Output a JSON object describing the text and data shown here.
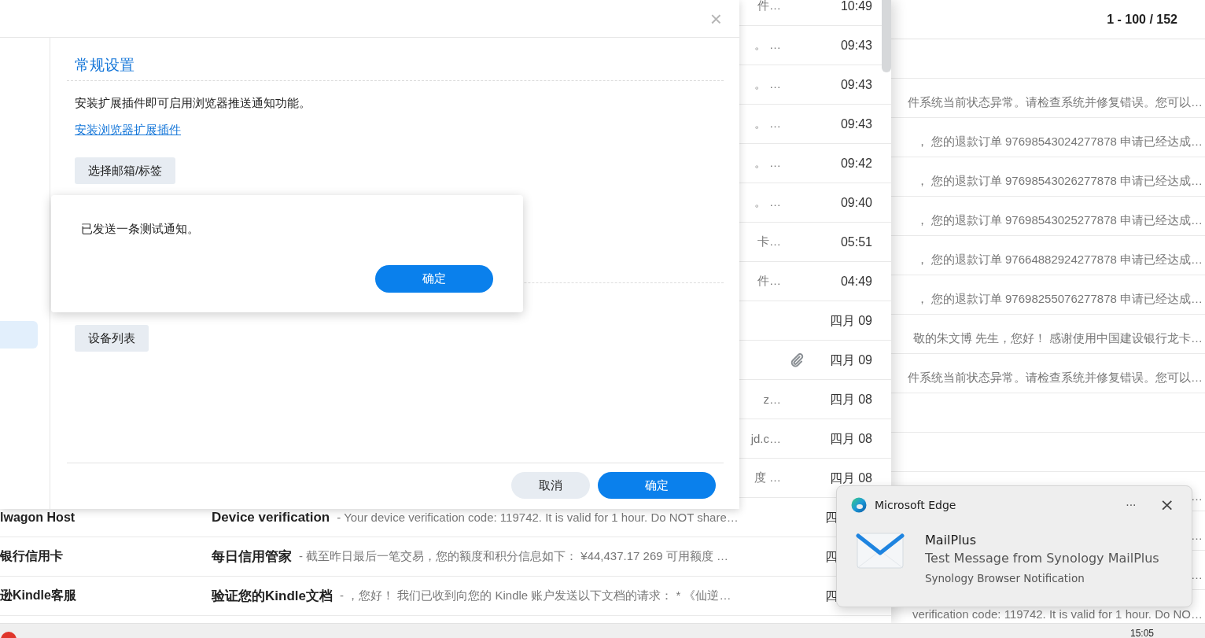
{
  "mail_list": {
    "rows": [
      {
        "snippet": "件…",
        "attachment": false,
        "time": "10:49"
      },
      {
        "snippet": "。 …",
        "attachment": false,
        "time": "09:43"
      },
      {
        "snippet": "。 …",
        "attachment": false,
        "time": "09:43"
      },
      {
        "snippet": "。 …",
        "attachment": false,
        "time": "09:43"
      },
      {
        "snippet": "。 …",
        "attachment": false,
        "time": "09:42"
      },
      {
        "snippet": "。 …",
        "attachment": false,
        "time": "09:40"
      },
      {
        "snippet": "卡…",
        "attachment": false,
        "time": "05:51"
      },
      {
        "snippet": "件…",
        "attachment": false,
        "time": "04:49"
      },
      {
        "snippet": "",
        "attachment": false,
        "time": "四月 09"
      },
      {
        "snippet": "",
        "attachment": true,
        "time": "四月 09"
      },
      {
        "snippet": "z…",
        "attachment": false,
        "time": "四月 08"
      },
      {
        "snippet": "jd.c…",
        "attachment": false,
        "time": "四月 08"
      },
      {
        "snippet": "度 …",
        "attachment": false,
        "time": "四月 08"
      },
      {
        "sender": "lwagon Host",
        "subject": "Device verification",
        "snippet": "- Your device verification code: 119742. It is valid for 1 hour. Do NOT share…",
        "attachment": false,
        "time": "四"
      },
      {
        "sender": "银行信用卡",
        "subject": "每日信用管家",
        "snippet": "- 截至昨日最后一笔交易，您的额度和积分信息如下： ¥44,437.17 269 可用额度 …",
        "attachment": false,
        "time": "四"
      },
      {
        "sender": "逊Kindle客服",
        "subject": "验证您的Kindle文档",
        "snippet": "- ，您好！ 我们已收到向您的 Kindle 账户发送以下文档的请求： * 《仙逆…",
        "attachment": false,
        "time": "四"
      }
    ]
  },
  "message_list": {
    "range": "1 - 100 / 152",
    "rows": [
      {
        "snippet": ""
      },
      {
        "snippet": "件系统当前状态异常。请检查系统并修复错误。您可以…"
      },
      {
        "snippet": "， 您的退款订单 97698543024277878 申请已经达成…"
      },
      {
        "snippet": "， 您的退款订单 97698543026277878 申请已经达成…"
      },
      {
        "snippet": "， 您的退款订单 97698543025277878 申请已经达成…"
      },
      {
        "snippet": "， 您的退款订单 97664882924277878 申请已经达成…"
      },
      {
        "snippet": "， 您的退款订单 97698255076277878 申请已经达成…"
      },
      {
        "snippet": "敬的朱文博 先生，您好！ 感谢使用中国建设银行龙卡…"
      },
      {
        "snippet": "件系统当前状态异常。请检查系统并修复错误。您可以…"
      },
      {
        "snippet": ""
      },
      {
        "snippet": ""
      },
      {
        "snippet": "…"
      },
      {
        "snippet": "…"
      },
      {
        "snippet": "…"
      },
      {
        "snippet": "verification code: 119742. It is valid for 1 hour. Do NO…"
      }
    ]
  },
  "settings_dialog": {
    "close": "×",
    "sidebar": {
      "items": [
        {
          "selected": true
        }
      ]
    },
    "title": "常规设置",
    "description": "安装扩展插件即可启用浏览器推送通知功能。",
    "link": "安装浏览器扩展插件",
    "buttons": [
      "选择邮箱/标签",
      "设备列表"
    ],
    "footer_buttons": [
      {
        "label": "取消",
        "kind": "secondary"
      },
      {
        "label": "确定",
        "kind": "primary"
      }
    ]
  },
  "alert": {
    "message": "已发送一条测试通知。",
    "button": "确定"
  },
  "notification": {
    "app": "Microsoft Edge",
    "more": "···",
    "close": "×",
    "title": "MailPlus",
    "message": "Test Message from Synology MailPlus",
    "source": "Synology Browser Notification"
  },
  "taskbar": {
    "time": "15:05"
  }
}
